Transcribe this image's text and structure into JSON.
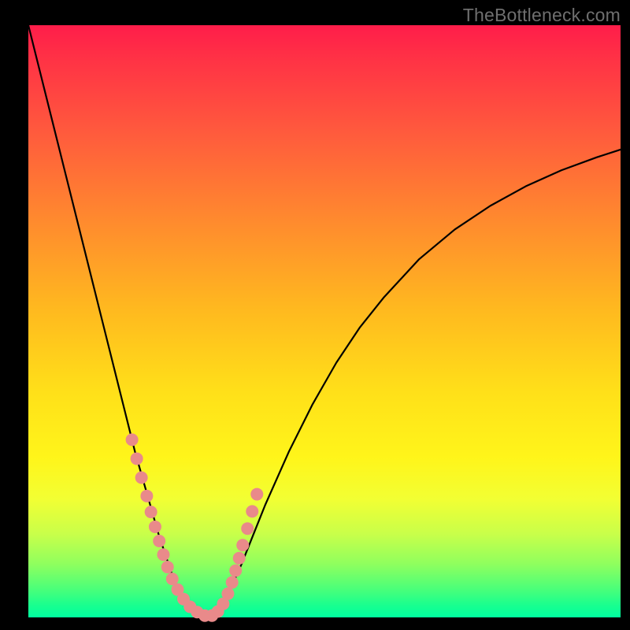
{
  "watermark": "TheBottleneck.com",
  "colors": {
    "curve_stroke": "#000000",
    "marker_fill": "#e98a8a",
    "marker_stroke": "#d86f6f"
  },
  "chart_data": {
    "type": "line",
    "title": "",
    "xlabel": "",
    "ylabel": "",
    "xlim": [
      0,
      100
    ],
    "ylim": [
      0,
      100
    ],
    "series": [
      {
        "name": "bottleneck-curve",
        "x": [
          0,
          2,
          4,
          6,
          8,
          10,
          12,
          14,
          16,
          18,
          20,
          21,
          22,
          23,
          24,
          25,
          26,
          27,
          28,
          29,
          30,
          31,
          32,
          33,
          34,
          36,
          38,
          40,
          44,
          48,
          52,
          56,
          60,
          66,
          72,
          78,
          84,
          90,
          96,
          100
        ],
        "y": [
          100,
          92,
          84,
          76,
          68,
          60,
          52,
          44,
          36,
          28,
          21,
          17.5,
          14,
          11,
          8,
          5.5,
          3.5,
          2,
          1,
          0.4,
          0,
          0.4,
          1.2,
          2.5,
          4.5,
          9,
          14,
          19,
          28,
          36,
          43,
          49,
          54,
          60.5,
          65.5,
          69.5,
          72.8,
          75.5,
          77.7,
          79
        ]
      }
    ],
    "markers": {
      "name": "highlighted-points",
      "x": [
        17.5,
        18.3,
        19.1,
        20.0,
        20.7,
        21.4,
        22.1,
        22.8,
        23.5,
        24.3,
        25.2,
        26.2,
        27.3,
        28.5,
        29.8,
        31.0,
        32.0,
        32.9,
        33.7,
        34.4,
        35.0,
        35.6,
        36.2,
        37.0,
        37.8,
        38.6
      ],
      "y": [
        30.0,
        26.8,
        23.6,
        20.5,
        17.8,
        15.3,
        12.9,
        10.6,
        8.5,
        6.5,
        4.7,
        3.1,
        1.8,
        0.9,
        0.3,
        0.3,
        1.0,
        2.3,
        4.0,
        5.9,
        7.9,
        10.0,
        12.2,
        15.0,
        17.9,
        20.8
      ]
    }
  }
}
